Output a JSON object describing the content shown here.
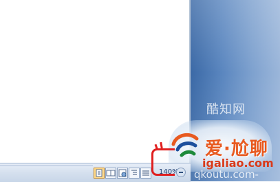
{
  "status_bar": {
    "zoom_level": "140%",
    "view_buttons": [
      "print-layout",
      "full-screen-reading",
      "web-layout",
      "outline",
      "draft"
    ],
    "active_view": "print-layout"
  },
  "watermark": {
    "chinese_text": "爱·尬聊",
    "url_text": "igaliao.com",
    "faded_top_text": "酷知网",
    "faded_bottom_text": "qkoutu.com-"
  },
  "colors": {
    "side_panel": "#5a86bf",
    "status_bar": "#d5e0ee",
    "highlight_red": "#e02020",
    "watermark_orange": "#e85a20"
  }
}
